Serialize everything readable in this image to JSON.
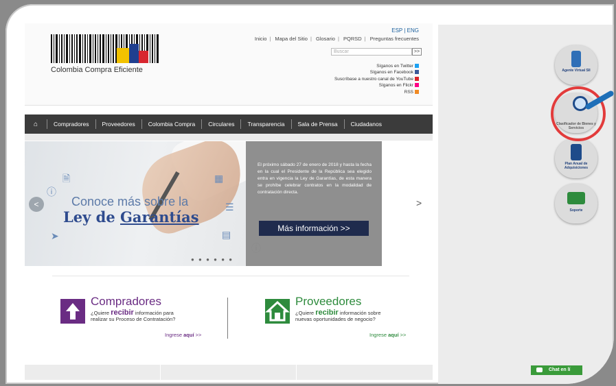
{
  "header": {
    "logo_text": "Colombia Compra Eficiente",
    "lang": [
      "ESP",
      "ENG"
    ],
    "top_links": [
      "Inicio",
      "Mapa del Sitio",
      "Glosario",
      "PQRSD",
      "Preguntas frecuentes"
    ],
    "search_placeholder": "Buscar",
    "search_button": ">>",
    "social": [
      {
        "label": "Síganos en Twitter",
        "color": "#1da1f2"
      },
      {
        "label": "Síganos en Facebook",
        "color": "#3b5998"
      },
      {
        "label": "Suscríbase a nuestro canal de YouTube",
        "color": "#d9252a"
      },
      {
        "label": "Síganos en Flickr",
        "color": "#ff0084"
      },
      {
        "label": "RSS",
        "color": "#f08a24"
      }
    ]
  },
  "nav": {
    "home_icon": "home-icon",
    "items": [
      "Compradores",
      "Proveedores",
      "Colombia Compra",
      "Circulares",
      "Transparencia",
      "Sala de Prensa",
      "Ciudadanos"
    ]
  },
  "slider": {
    "line1": "Conoce más sobre la",
    "line2a": "Ley de ",
    "line2b": "Garantías",
    "info_text": "El próximo sábado 27 de enero de 2018 y hasta la fecha en la cual el Presidente de la República sea elegido entra en vigencia la Ley de Garantías, de esta manera se prohíbe celebrar contratos en la modalidad de contratación directa.",
    "button": "Más información  >>",
    "prev": "<",
    "next": ">",
    "dots": "● ● ● ● ● ●"
  },
  "cards": {
    "compradores": {
      "title": "Compradores",
      "desc_pre": "¿Quiere ",
      "desc_bold": "recibir",
      "desc_post": " información para",
      "desc_line2": "realizar su Proceso de Contratación?",
      "link_pre": "Ingrese ",
      "link_bold": "aquí",
      "link_post": " >>",
      "color": "#6a2c83"
    },
    "proveedores": {
      "title": "Proveedores",
      "desc_pre": "¿Quiere ",
      "desc_bold": "recibir",
      "desc_post": " información sobre",
      "desc_line2": "nuevas oportunidades de negocio?",
      "link_pre": "Ingrese ",
      "link_bold": "aquí",
      "link_post": " >>",
      "color": "#2e8b3d"
    }
  },
  "side_buttons": [
    {
      "label": "Agente Virtual SII",
      "icon": "robot-icon"
    },
    {
      "label": "Clasificador de Bienes y Servicios",
      "icon": "magnifier-icon"
    },
    {
      "label": "Plan Anual de Adquisiciones",
      "icon": "document-icon"
    },
    {
      "label": "Soporte",
      "icon": "monitor-icon"
    }
  ],
  "chat": {
    "label": "Chat en lí"
  }
}
